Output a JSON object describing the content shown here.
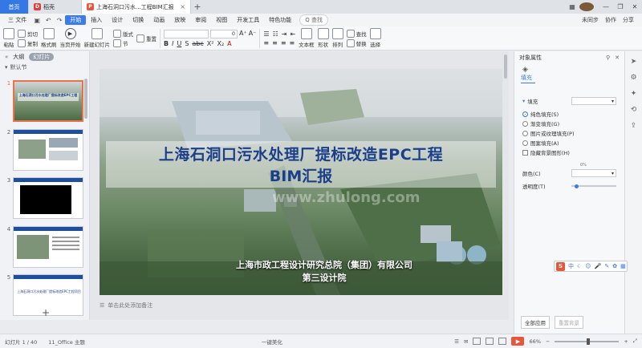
{
  "titlebar": {
    "home_tab": "首页",
    "store_tab": "稻壳",
    "doc_tab": "上海石洞口污水...工程BIM汇报",
    "add_tab": "+"
  },
  "menubar": {
    "file": "三 文件",
    "items": [
      "开始",
      "插入",
      "设计",
      "切换",
      "动画",
      "放映",
      "审阅",
      "视图",
      "开发工具",
      "特色功能"
    ],
    "search": "Q 查找",
    "right": [
      "未同步",
      "协作",
      "分享"
    ]
  },
  "ribbon": {
    "paste": "粘贴",
    "cut": "剪切",
    "copy": "复制",
    "format_painter": "格式刷",
    "play": "当页开始",
    "new_slide": "新建幻灯片",
    "layout": "版式",
    "section": "节",
    "reset": "重置",
    "font_name": "",
    "font_size": "0",
    "textbox": "文本框",
    "shapes": "形状",
    "arrange": "排列",
    "find": "查找",
    "replace": "替换",
    "select": "选择"
  },
  "leftpanel": {
    "outline_tab": "大纲",
    "slides_tab": "幻灯片",
    "section": "默认节",
    "thumbs": [
      "1",
      "2",
      "3",
      "4",
      "5"
    ],
    "thumb1_title": "上海石洞口污水处理厂提标改造EPC工程",
    "thumb5_text": "上海石洞口污水处理厂提标改造EPC工程项目"
  },
  "slide": {
    "title_line1": "上海石洞口污水处理厂提标改造EPC工程",
    "title_line2": "BIM汇报",
    "org_line1": "上海市政工程设计研究总院（集团）有限公司",
    "org_line2": "第三设计院",
    "watermark": "www.zhulong.com"
  },
  "notes": {
    "placeholder": "单击此处添加备注"
  },
  "rightpanel": {
    "title": "对象属性",
    "tab": "填充",
    "fill_section": "填充",
    "fill_select": "",
    "options": [
      "纯色填充(S)",
      "渐变填充(G)",
      "图片或纹理填充(P)",
      "图案填充(A)"
    ],
    "hide_bg": "隐藏背景图形(H)",
    "color_label": "颜色(C)",
    "transparency_label": "透明度(T)",
    "transparency_value": "0%",
    "apply_all": "全部应用",
    "reset_bg": "重置背景"
  },
  "statusbar": {
    "slide_info": "幻灯片 1 / 40",
    "theme": "11_Office 主题",
    "beautify": "一键美化",
    "zoom": "66%"
  },
  "ime": {
    "logo": "S",
    "mode": "中"
  },
  "colors": {
    "accent": "#3c7bea",
    "ppt_orange": "#e8563a",
    "slide_title": "#1c3f8c"
  }
}
